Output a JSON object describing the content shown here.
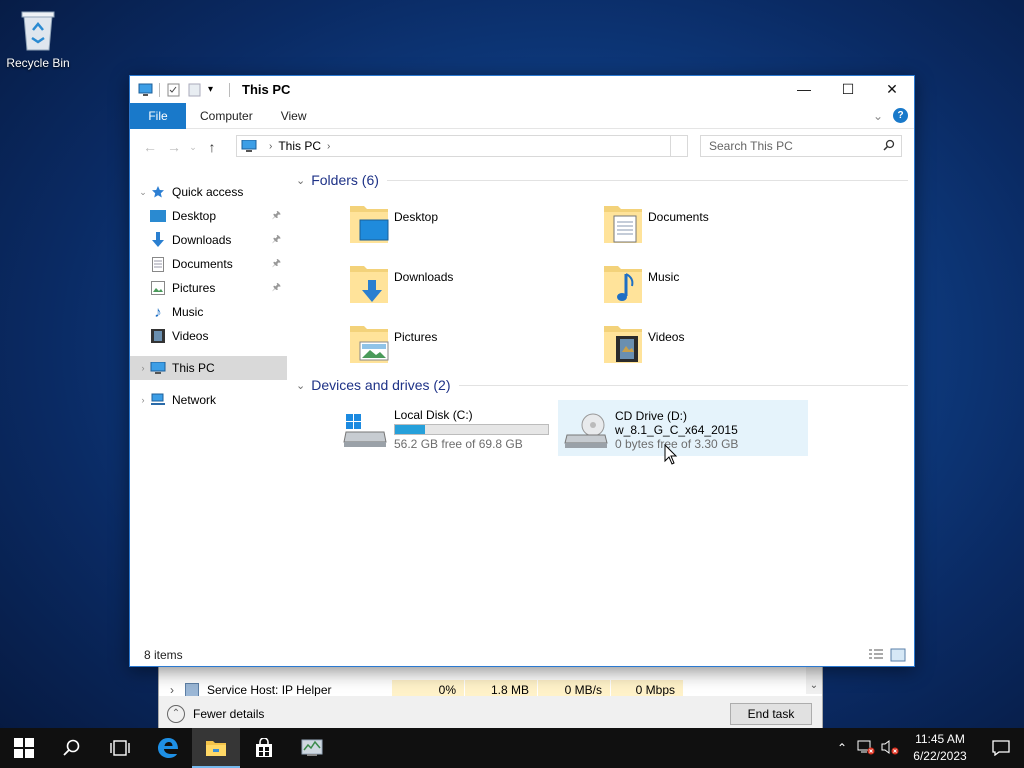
{
  "desktop": {
    "recycle_bin_label": "Recycle Bin"
  },
  "window": {
    "title": "This PC",
    "ribbon_tabs": [
      "File",
      "Computer",
      "View"
    ],
    "address": {
      "location": "This PC"
    },
    "search": {
      "placeholder": "Search This PC"
    },
    "navigation": {
      "quick_access": "Quick access",
      "quick_items": [
        {
          "label": "Desktop",
          "pinned": true
        },
        {
          "label": "Downloads",
          "pinned": true
        },
        {
          "label": "Documents",
          "pinned": true
        },
        {
          "label": "Pictures",
          "pinned": true
        },
        {
          "label": "Music",
          "pinned": false
        },
        {
          "label": "Videos",
          "pinned": false
        }
      ],
      "this_pc": "This PC",
      "network": "Network"
    },
    "folders_header": "Folders (6)",
    "folders": [
      "Desktop",
      "Documents",
      "Downloads",
      "Music",
      "Pictures",
      "Videos"
    ],
    "devices_header": "Devices and drives (2)",
    "drives": [
      {
        "name": "Local Disk (C:)",
        "free_text": "56.2 GB free of 69.8 GB",
        "used_fraction": 0.195
      },
      {
        "name": "CD Drive (D:)",
        "label": "w_8.1_G_C_x64_2015",
        "free_text": "0 bytes free of 3.30 GB"
      }
    ],
    "status": "8 items"
  },
  "taskmgr": {
    "row": {
      "name": "Service Host: IP Helper",
      "cpu": "0%",
      "memory": "1.8 MB",
      "disk": "0 MB/s",
      "network": "0 Mbps"
    },
    "fewer_details": "Fewer details",
    "end_task": "End task"
  },
  "taskbar": {
    "time": "11:45 AM",
    "date": "6/22/2023",
    "accent": "#76b9ed"
  }
}
